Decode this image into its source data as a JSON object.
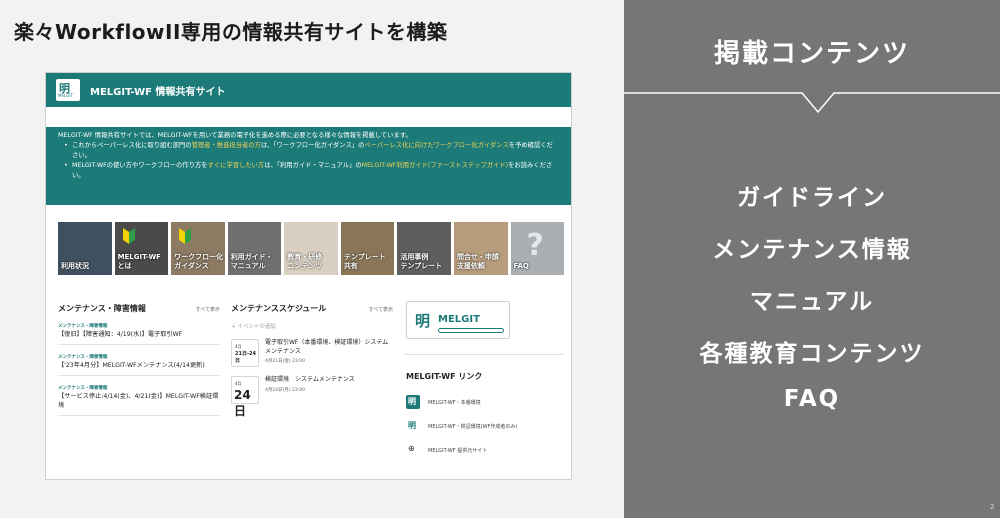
{
  "slide_title": "楽々WorkflowII専用の情報共有サイトを構築",
  "site": {
    "logo_glyph": "明",
    "logo_text": "MELGIT",
    "title": "MELGIT-WF 情報共有サイト",
    "intro": {
      "lead": "MELGIT-WF 情報共有サイトでは、MELGIT-WFを用いて業務の電子化を進める際に必要となる様々な情報を掲載しています。",
      "b1_pre": "これからペーパーレス化に取り組む部門の",
      "b1_hl1": "管理者・推進担当者の方",
      "b1_mid": "は、「ワークフロー化ガイダンス」の",
      "b1_hl2": "ペーパーレス化に向けたワークフロー化ガイダンス",
      "b1_post": "を予め確認ください。",
      "b2_pre": "MELGIT-WFの使い方やワークフローの作り方を",
      "b2_hl1": "すぐに学習したい方",
      "b2_mid": "は、「利用ガイド・マニュアル」の",
      "b2_hl2": "MELGIT-WF利用ガイド(ファーストステップガイド)",
      "b2_post": "をお読みください。"
    },
    "tiles": [
      {
        "label": "利用状況",
        "color": "#3f5060"
      },
      {
        "label": "MELGIT-WF\nとは",
        "color": "#4a4a4a"
      },
      {
        "label": "ワークフロー化\nガイダンス",
        "color": "#8d7a63"
      },
      {
        "label": "利用ガイド・\nマニュアル",
        "color": "#6f6f6f"
      },
      {
        "label": "教育・研修\nコンテンツ",
        "color": "#d8cfc0"
      },
      {
        "label": "テンプレート\n共有",
        "color": "#8a7558"
      },
      {
        "label": "活用事例\nテンプレート",
        "color": "#5e5e5e"
      },
      {
        "label": "問合せ・申請\n支援依頼",
        "color": "#b79c7c"
      },
      {
        "label": "FAQ",
        "color": "#a9aeb3"
      }
    ],
    "faq_symbol": "?",
    "maintenance": {
      "title": "メンテナンス・障害情報",
      "see_all": "すべて表示",
      "items": [
        {
          "tag": "メンテナンス・障害情報",
          "text": "【復旧】【障害通知：4/19(水)】電子取引WF"
        },
        {
          "tag": "メンテナンス・障害情報",
          "text": "【'23年4月分】MELGIT-WFメンテナンス(4/14更新)"
        },
        {
          "tag": "メンテナンス・障害情報",
          "text": "【サービス停止:4/14(金)、4/21(金)】MELGIT-WF検証環境"
        }
      ]
    },
    "schedule": {
      "title": "メンテナンススケジュール",
      "see_all": "すべて表示",
      "add_event": "+ イベントの追加",
      "events": [
        {
          "month": "4月",
          "day": "21日-24日",
          "title": "電子取引WF（本番環境、検証環境）システムメンテナンス",
          "time": "4月21日(金) 23:00"
        },
        {
          "month": "4月",
          "day": "24日",
          "title": "検証環境　システムメンテナンス",
          "time": "4月24日(月) 23:00"
        }
      ]
    },
    "banner": {
      "glyph": "明",
      "text": "MELGIT",
      "sub": "WF"
    },
    "links": {
      "title": "MELGIT-WF リンク",
      "items": [
        {
          "text": "MELGIT-WF・本番環境",
          "glyph": "明",
          "bg": "#1c7b78",
          "fg": "#ffffff"
        },
        {
          "text": "MELGIT-WF・検証環境(WF作成者のみ)",
          "glyph": "明",
          "bg": "#ffffff",
          "fg": "#1c7b78"
        },
        {
          "text": "MELGIT-WF 提供元サイト",
          "glyph": "⊕",
          "bg": "#ffffff",
          "fg": "#555555"
        }
      ]
    }
  },
  "panel": {
    "title": "掲載コンテンツ",
    "items": [
      "ガイドライン",
      "メンテナンス情報",
      "マニュアル",
      "各種教育コンテンツ",
      "FAQ"
    ]
  },
  "page_number": "2",
  "colors": {
    "teal": "#1c7b78",
    "panel_gray": "#767676",
    "highlight": "#f0cf55"
  }
}
